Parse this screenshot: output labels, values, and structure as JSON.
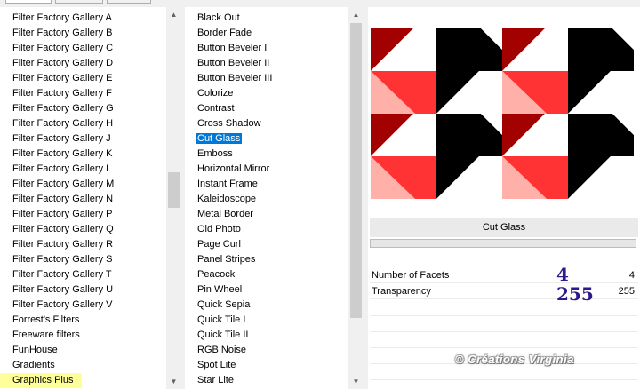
{
  "categories": [
    "Filter Factory Gallery A",
    "Filter Factory Gallery B",
    "Filter Factory Gallery C",
    "Filter Factory Gallery D",
    "Filter Factory Gallery E",
    "Filter Factory Gallery F",
    "Filter Factory Gallery G",
    "Filter Factory Gallery H",
    "Filter Factory Gallery J",
    "Filter Factory Gallery K",
    "Filter Factory Gallery L",
    "Filter Factory Gallery M",
    "Filter Factory Gallery N",
    "Filter Factory Gallery P",
    "Filter Factory Gallery Q",
    "Filter Factory Gallery R",
    "Filter Factory Gallery S",
    "Filter Factory Gallery T",
    "Filter Factory Gallery U",
    "Filter Factory Gallery V",
    "Forrest's Filters",
    "Freeware filters",
    "FunHouse",
    "Gradients",
    "Graphics Plus"
  ],
  "selected_category": "Graphics Plus",
  "filters": [
    "Black Out",
    "Border Fade",
    "Button Beveler I",
    "Button Beveler II",
    "Button Beveler III",
    "Colorize",
    "Contrast",
    "Cross Shadow",
    "Cut Glass",
    "Emboss",
    "Horizontal Mirror",
    "Instant Frame",
    "Kaleidoscope",
    "Metal Border",
    "Old Photo",
    "Page Curl",
    "Panel Stripes",
    "Peacock",
    "Pin Wheel",
    "Quick Sepia",
    "Quick Tile I",
    "Quick Tile II",
    "RGB Noise",
    "Spot Lite",
    "Star Lite"
  ],
  "selected_filter": "Cut Glass",
  "filter_title": "Cut Glass",
  "progress": 0,
  "params": [
    {
      "name": "Number of Facets",
      "annotation": "4",
      "value": "4"
    },
    {
      "name": "Transparency",
      "annotation": "255",
      "value": "255"
    }
  ],
  "watermark": "© Créations Virginia",
  "colors": {
    "dark_red": "#a30000",
    "red": "#ff3333",
    "pink": "#ffb0a8",
    "black": "#000000",
    "white": "#ffffff",
    "selection": "#0078d7",
    "highlight": "#ffff99",
    "annotation": "#2b1a8a"
  }
}
